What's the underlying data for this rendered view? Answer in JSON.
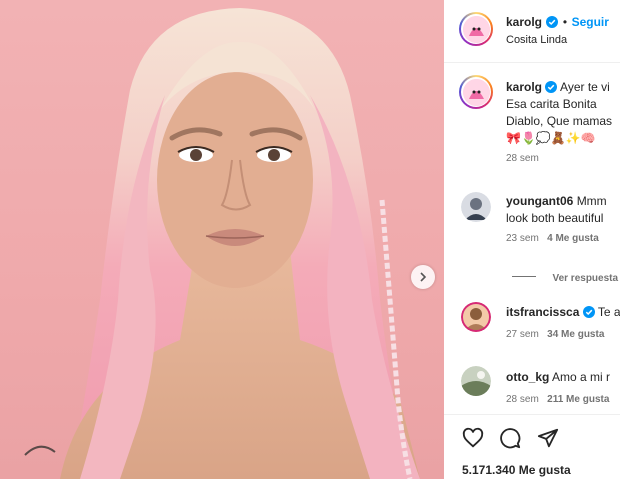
{
  "post": {
    "author": "karolg",
    "follow_label": "Seguir",
    "dot": "•",
    "audio": "Cosita Linda",
    "caption_lines": [
      "Ayer te vi",
      "Esa carita Bonita",
      "Diablo, Que mamas",
      "🎀🌷💭🧸✨🧠"
    ],
    "caption_time": "28 sem",
    "likes": "5.171.340 Me gusta"
  },
  "comments": [
    {
      "user": "youngant06",
      "lines": [
        "Mmm",
        "look both beautiful"
      ],
      "time": "23 sem",
      "likes": "4 Me gusta"
    },
    {
      "view_replies": "Ver respuesta"
    },
    {
      "user": "itsfrancissca",
      "lines": [
        "Te a"
      ],
      "time": "27 sem",
      "likes": "34 Me gusta"
    },
    {
      "user": "otto_kg",
      "lines": [
        "Amo a mi r"
      ],
      "time": "28 sem",
      "likes": "211 Me gusta"
    }
  ],
  "icons": {
    "carousel_next": "chevron-right-icon",
    "like": "heart-icon",
    "comment": "comment-icon",
    "share": "send-icon",
    "verified": "verified-badge-icon"
  },
  "colors": {
    "accent": "#0095f6",
    "photo_bg": "#f0adaf",
    "hair": "#f3a4b4",
    "verified": "#0095f6"
  }
}
